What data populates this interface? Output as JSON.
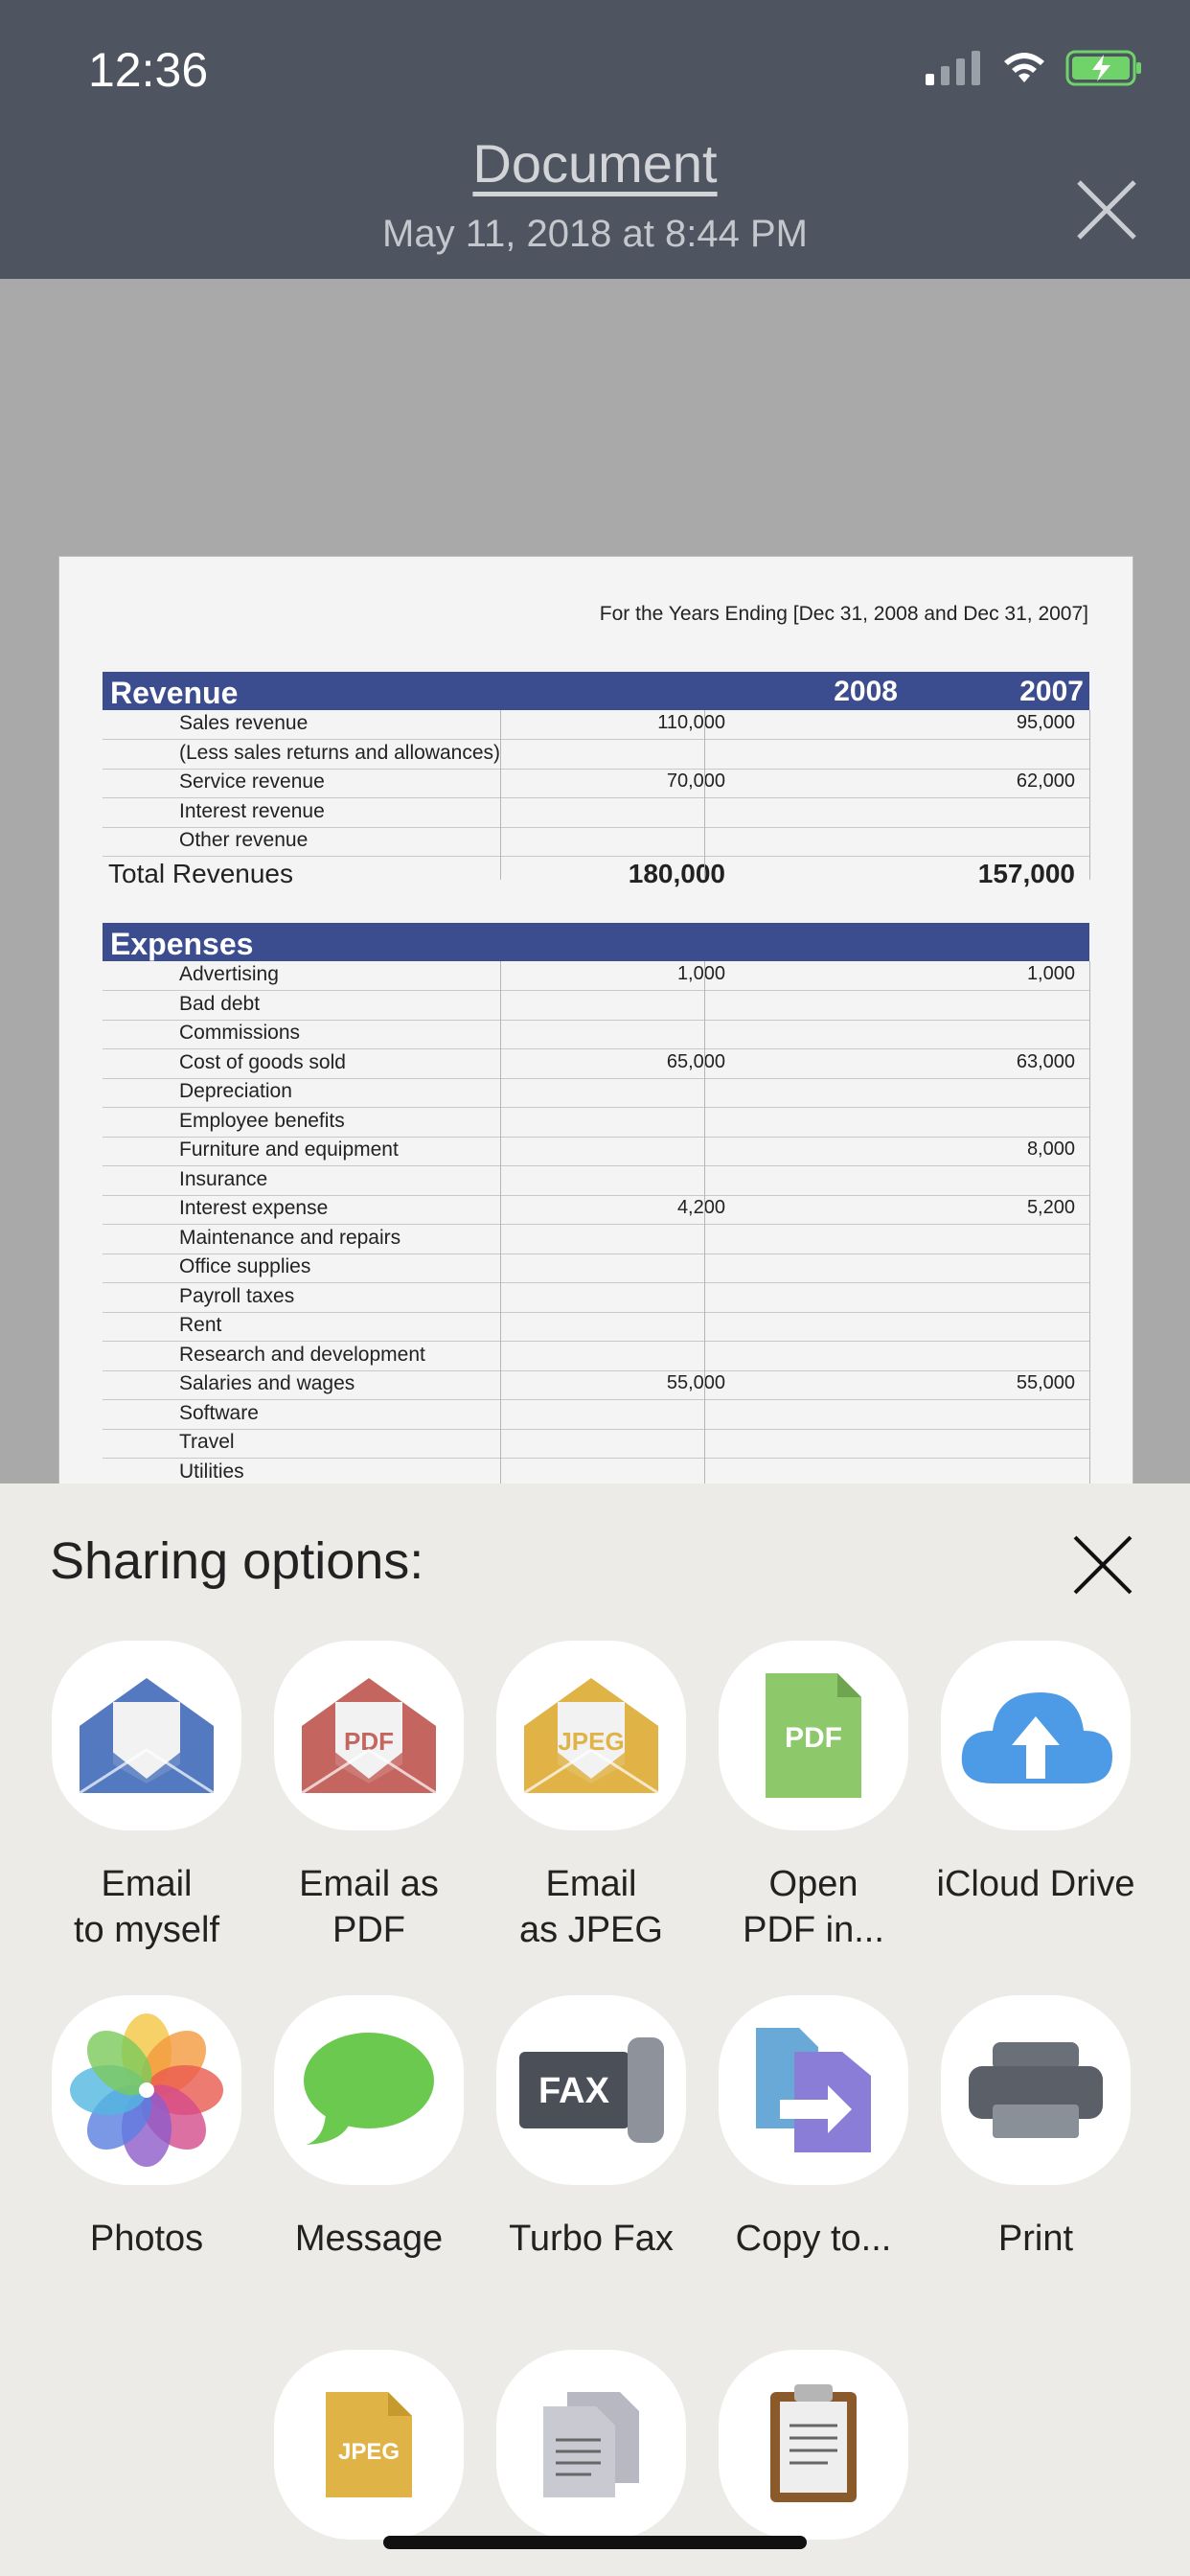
{
  "status": {
    "time": "12:36"
  },
  "header": {
    "title": "Document",
    "date": "May 11, 2018 at 8:44 PM"
  },
  "document": {
    "caption": "For the Years Ending [Dec 31, 2008 and Dec 31, 2007]",
    "revenue_header": "Revenue",
    "year1": "2008",
    "year2": "2007",
    "revenue_rows": [
      {
        "label": "Sales revenue",
        "v2008": "110,000",
        "v2007": "95,000"
      },
      {
        "label": "(Less sales returns and allowances)",
        "v2008": "",
        "v2007": ""
      },
      {
        "label": "Service revenue",
        "v2008": "70,000",
        "v2007": "62,000"
      },
      {
        "label": "Interest revenue",
        "v2008": "",
        "v2007": ""
      },
      {
        "label": "Other revenue",
        "v2008": "",
        "v2007": ""
      }
    ],
    "total_revenues": {
      "label": "Total Revenues",
      "v2008": "180,000",
      "v2007": "157,000"
    },
    "expenses_header": "Expenses",
    "expense_rows": [
      {
        "label": "Advertising",
        "v2008": "1,000",
        "v2007": "1,000"
      },
      {
        "label": "Bad debt",
        "v2008": "",
        "v2007": ""
      },
      {
        "label": "Commissions",
        "v2008": "",
        "v2007": ""
      },
      {
        "label": "Cost of goods sold",
        "v2008": "65,000",
        "v2007": "63,000"
      },
      {
        "label": "Depreciation",
        "v2008": "",
        "v2007": ""
      },
      {
        "label": "Employee benefits",
        "v2008": "",
        "v2007": ""
      },
      {
        "label": "Furniture and equipment",
        "v2008": "",
        "v2007": "8,000"
      },
      {
        "label": "Insurance",
        "v2008": "",
        "v2007": ""
      },
      {
        "label": "Interest expense",
        "v2008": "4,200",
        "v2007": "5,200"
      },
      {
        "label": "Maintenance and repairs",
        "v2008": "",
        "v2007": ""
      },
      {
        "label": "Office supplies",
        "v2008": "",
        "v2007": ""
      },
      {
        "label": "Payroll taxes",
        "v2008": "",
        "v2007": ""
      },
      {
        "label": "Rent",
        "v2008": "",
        "v2007": ""
      },
      {
        "label": "Research and development",
        "v2008": "",
        "v2007": ""
      },
      {
        "label": "Salaries and wages",
        "v2008": "55,000",
        "v2007": "55,000"
      },
      {
        "label": "Software",
        "v2008": "",
        "v2007": ""
      },
      {
        "label": "Travel",
        "v2008": "",
        "v2007": ""
      },
      {
        "label": "Utilities",
        "v2008": "",
        "v2007": ""
      }
    ]
  },
  "sheet": {
    "title": "Sharing options:",
    "items": [
      {
        "label": "Email\nto myself",
        "icon": "envelope-blue-icon",
        "color": "#5479c0"
      },
      {
        "label": "Email as PDF",
        "icon": "envelope-pdf-icon",
        "color": "#c4655f",
        "badge": "PDF"
      },
      {
        "label": "Email\nas JPEG",
        "icon": "envelope-jpeg-icon",
        "color": "#e0b346",
        "badge": "JPEG"
      },
      {
        "label": "Open\nPDF in...",
        "icon": "pdf-file-icon",
        "color": "#8dc86a",
        "badge": "PDF"
      },
      {
        "label": "iCloud Drive",
        "icon": "icloud-upload-icon",
        "color": "#4d9ae6"
      },
      {
        "label": "Photos",
        "icon": "photos-icon"
      },
      {
        "label": "Message",
        "icon": "message-bubble-icon",
        "color": "#6bc950"
      },
      {
        "label": "Turbo Fax",
        "icon": "fax-icon",
        "color": "#4b4f58",
        "badge": "FAX"
      },
      {
        "label": "Copy to...",
        "icon": "copy-to-icon",
        "color": "#8a7dd8"
      },
      {
        "label": "Print",
        "icon": "printer-icon",
        "color": "#5b6068"
      },
      {
        "label": "",
        "icon": "jpeg-file-icon",
        "color": "#e0b346",
        "badge": "JPEG"
      },
      {
        "label": "",
        "icon": "documents-icon",
        "color": "#c9c9d2"
      },
      {
        "label": "",
        "icon": "clipboard-icon",
        "color": "#8a5a2b"
      }
    ]
  }
}
